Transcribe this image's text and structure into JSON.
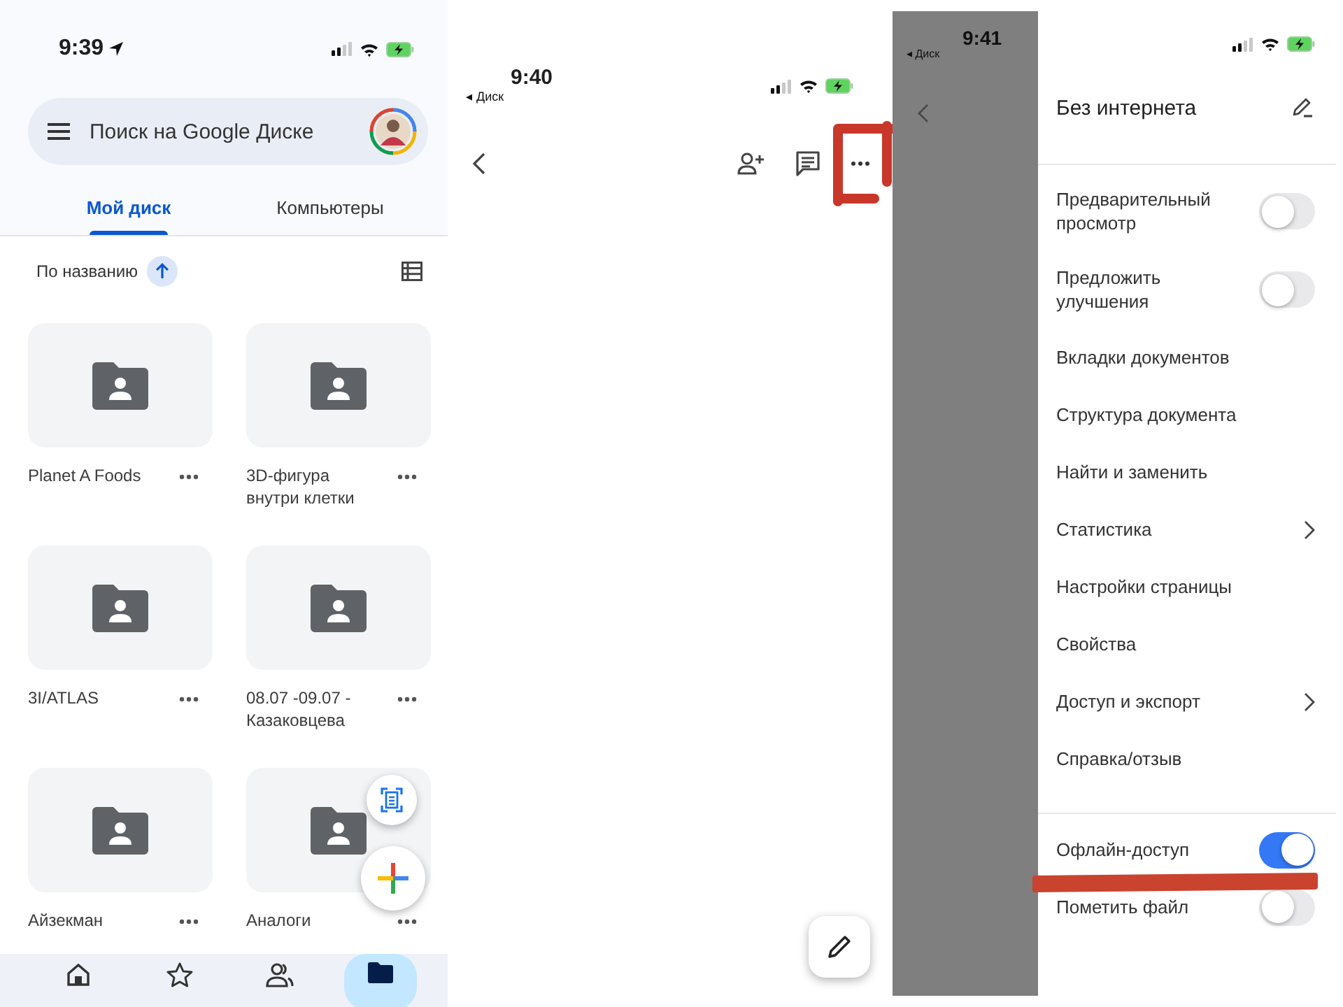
{
  "drive_screen": {
    "status_time": "9:39",
    "search": {
      "placeholder": "Поиск на Google Диске"
    },
    "tabs": [
      {
        "label": "Мой диск",
        "selected": true
      },
      {
        "label": "Компьютеры",
        "selected": false
      }
    ],
    "sort": {
      "label": "По названию"
    },
    "folders": [
      {
        "name": "Planet A Foods"
      },
      {
        "name": "3D-фигура внутри клетки"
      },
      {
        "name": "3I/ATLAS"
      },
      {
        "name": "08.07 -09.07 - Казаковцева"
      },
      {
        "name": "Айзекман"
      },
      {
        "name": "Аналоги"
      }
    ],
    "nav": [
      {
        "kind": "home",
        "selected": false
      },
      {
        "kind": "starred",
        "selected": false
      },
      {
        "kind": "shared",
        "selected": false
      },
      {
        "kind": "files",
        "selected": true
      }
    ]
  },
  "document_screen": {
    "status_time": "9:40",
    "back_app": "◂ Диск"
  },
  "menu_screen": {
    "status_time": "9:41",
    "back_app": "◂ Диск",
    "title": "Без интернета",
    "sections": [
      {
        "items": [
          {
            "kind": "toggle",
            "label": "Предварительный просмотр",
            "on": false
          },
          {
            "kind": "toggle",
            "label": "Предложить улучшения",
            "on": false
          },
          {
            "kind": "link",
            "label": "Вкладки документов"
          },
          {
            "kind": "link",
            "label": "Структура документа"
          },
          {
            "kind": "link",
            "label": "Найти и заменить"
          },
          {
            "kind": "submenu",
            "label": "Статистика"
          },
          {
            "kind": "link",
            "label": "Настройки страницы"
          },
          {
            "kind": "link",
            "label": "Свойства"
          },
          {
            "kind": "submenu",
            "label": "Доступ и экспорт"
          },
          {
            "kind": "link",
            "label": "Справка/отзыв"
          }
        ]
      },
      {
        "items": [
          {
            "kind": "toggle",
            "label": "Офлайн-доступ",
            "on": true
          },
          {
            "kind": "toggle",
            "label": "Пометить файл",
            "on": false
          }
        ]
      }
    ]
  }
}
